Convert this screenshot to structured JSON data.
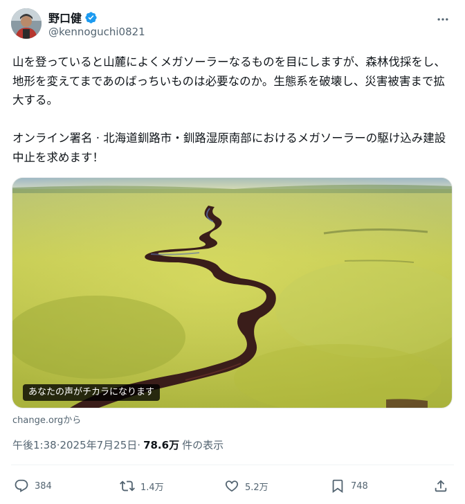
{
  "author": {
    "display_name": "野口健",
    "handle": "@kennoguchi0821",
    "avatar_icon": "avatar-photo",
    "verified_icon": "verified-badge-icon"
  },
  "tweet": {
    "text": "山を登っていると山麓によくメガソーラーなるものを目にしますが、森林伐採をし、地形を変えてまであのばっちいものは必要なのか。生態系を破壊し、災害被害まで拡大する。\n\nオンライン署名 · 北海道釧路市・釧路湿原南部におけるメガソーラーの駆け込み建設中止を求めます！"
  },
  "card": {
    "overlay_text": "あなたの声がチカラになります",
    "source": "change.orgから"
  },
  "meta": {
    "time": "午後1:38",
    "separator1": " · ",
    "date": "2025年7月25日",
    "separator2": " · ",
    "views": "78.6万",
    "views_label": "件の表示"
  },
  "actions": {
    "replies": "384",
    "reposts": "1.4万",
    "likes": "5.2万",
    "bookmarks": "748"
  },
  "colors": {
    "text": "#0f1419",
    "secondary": "#536471",
    "verified_blue": "#1d9bf0"
  }
}
